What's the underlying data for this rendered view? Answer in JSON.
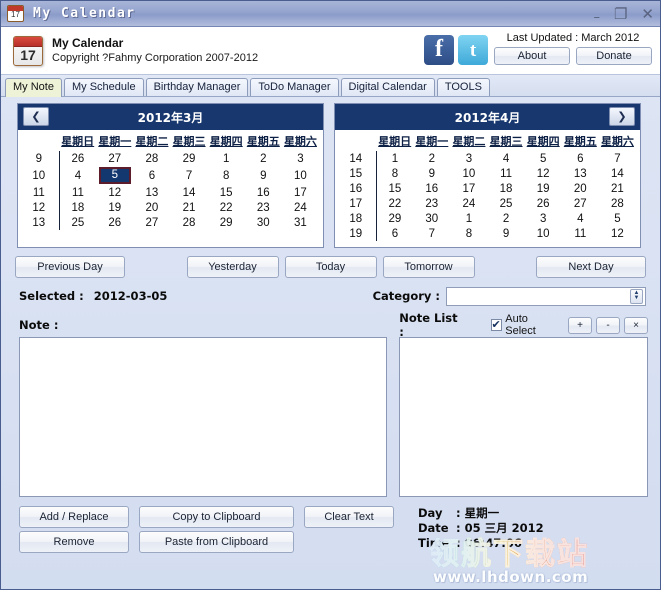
{
  "window": {
    "title": "My Calendar",
    "icon_day": "17",
    "controls": {
      "minimize": "–",
      "maximize": "❐",
      "close": "✕"
    }
  },
  "header": {
    "app_name": "My Calendar",
    "copyright": "Copyright ?Fahmy Corporation 2007-2012",
    "facebook_glyph": "f",
    "twitter_glyph": "t",
    "last_updated": "Last Updated : March 2012",
    "about_label": "About",
    "donate_label": "Donate"
  },
  "tabs": [
    {
      "label": "My Note",
      "active": true
    },
    {
      "label": "My Schedule",
      "active": false
    },
    {
      "label": "Birthday Manager",
      "active": false
    },
    {
      "label": "ToDo Manager",
      "active": false
    },
    {
      "label": "Digital Calendar",
      "active": false
    },
    {
      "label": "TOOLS",
      "active": false
    }
  ],
  "calendars": {
    "weekday_headers": [
      "星期日",
      "星期一",
      "星期二",
      "星期三",
      "星期四",
      "星期五",
      "星期六"
    ],
    "prev_glyph": "❮",
    "next_glyph": "❯",
    "left": {
      "title": "2012年3月",
      "week_numbers": [
        "9",
        "10",
        "11",
        "12",
        "13"
      ],
      "rows": [
        [
          {
            "d": "26",
            "out": true
          },
          {
            "d": "27",
            "out": true
          },
          {
            "d": "28",
            "out": true
          },
          {
            "d": "29",
            "out": true
          },
          {
            "d": "1"
          },
          {
            "d": "2"
          },
          {
            "d": "3"
          }
        ],
        [
          {
            "d": "4"
          },
          {
            "d": "5",
            "sel": true
          },
          {
            "d": "6"
          },
          {
            "d": "7"
          },
          {
            "d": "8"
          },
          {
            "d": "9"
          },
          {
            "d": "10"
          }
        ],
        [
          {
            "d": "11"
          },
          {
            "d": "12"
          },
          {
            "d": "13"
          },
          {
            "d": "14"
          },
          {
            "d": "15"
          },
          {
            "d": "16"
          },
          {
            "d": "17"
          }
        ],
        [
          {
            "d": "18"
          },
          {
            "d": "19"
          },
          {
            "d": "20"
          },
          {
            "d": "21"
          },
          {
            "d": "22"
          },
          {
            "d": "23"
          },
          {
            "d": "24"
          }
        ],
        [
          {
            "d": "25"
          },
          {
            "d": "26"
          },
          {
            "d": "27"
          },
          {
            "d": "28"
          },
          {
            "d": "29"
          },
          {
            "d": "30"
          },
          {
            "d": "31"
          }
        ]
      ]
    },
    "right": {
      "title": "2012年4月",
      "week_numbers": [
        "14",
        "15",
        "16",
        "17",
        "18",
        "19"
      ],
      "rows": [
        [
          {
            "d": "1"
          },
          {
            "d": "2"
          },
          {
            "d": "3"
          },
          {
            "d": "4"
          },
          {
            "d": "5"
          },
          {
            "d": "6"
          },
          {
            "d": "7"
          }
        ],
        [
          {
            "d": "8"
          },
          {
            "d": "9"
          },
          {
            "d": "10"
          },
          {
            "d": "11"
          },
          {
            "d": "12"
          },
          {
            "d": "13"
          },
          {
            "d": "14"
          }
        ],
        [
          {
            "d": "15"
          },
          {
            "d": "16"
          },
          {
            "d": "17"
          },
          {
            "d": "18"
          },
          {
            "d": "19"
          },
          {
            "d": "20"
          },
          {
            "d": "21"
          }
        ],
        [
          {
            "d": "22"
          },
          {
            "d": "23"
          },
          {
            "d": "24"
          },
          {
            "d": "25"
          },
          {
            "d": "26"
          },
          {
            "d": "27"
          },
          {
            "d": "28"
          }
        ],
        [
          {
            "d": "29"
          },
          {
            "d": "30"
          },
          {
            "d": "1",
            "out": true
          },
          {
            "d": "2",
            "out": true
          },
          {
            "d": "3",
            "out": true
          },
          {
            "d": "4",
            "out": true
          },
          {
            "d": "5",
            "out": true
          }
        ],
        [
          {
            "d": "6",
            "out": true
          },
          {
            "d": "7",
            "out": true
          },
          {
            "d": "8",
            "out": true
          },
          {
            "d": "9",
            "out": true
          },
          {
            "d": "10",
            "out": true
          },
          {
            "d": "11",
            "out": true
          },
          {
            "d": "12",
            "out": true
          }
        ]
      ]
    }
  },
  "daynav": {
    "previous_day": "Previous Day",
    "yesterday": "Yesterday",
    "today": "Today",
    "tomorrow": "Tomorrow",
    "next_day": "Next Day"
  },
  "selected": {
    "label": "Selected :",
    "value": "2012-03-05"
  },
  "category": {
    "label": "Category :",
    "value": "",
    "placeholder": ""
  },
  "note": {
    "label": "Note :",
    "value": "",
    "placeholder": ""
  },
  "note_list": {
    "label": "Note List :",
    "auto_select_label": "Auto Select",
    "auto_select_checked": true,
    "add_glyph": "+",
    "remove_glyph": "-",
    "clear_glyph": "×",
    "items": []
  },
  "actions": {
    "add_replace": "Add / Replace",
    "remove": "Remove",
    "copy_to_clipboard": "Copy to Clipboard",
    "paste_from_clipboard": "Paste from Clipboard",
    "clear_text": "Clear Text"
  },
  "info": {
    "day_key": "Day",
    "day_value": "星期一",
    "date_key": "Date",
    "date_value": "05 三月 2012",
    "time_key": "Time",
    "time_value": "06:47:06",
    "sep": ":"
  },
  "watermark": {
    "chinese": "领航下载站",
    "url": "www.lhdown.com"
  },
  "colors": {
    "titlebar": "#97a6cf",
    "calendar_header": "#17376e",
    "selected_day_bg": "#13386f",
    "selected_day_border": "#5c1c2c",
    "active_tab_bg": "#eef3d8",
    "window_bg": "#d9e1f2"
  }
}
